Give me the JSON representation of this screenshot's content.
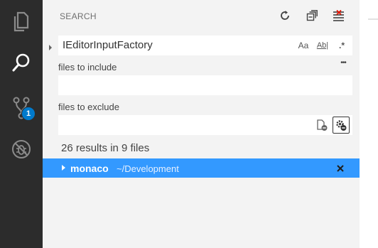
{
  "activity_bar": {
    "items": [
      {
        "icon": "files-icon"
      },
      {
        "icon": "search-icon",
        "active": true
      },
      {
        "icon": "source-control-icon",
        "badge": "1"
      },
      {
        "icon": "debug-icon"
      }
    ],
    "colors": {
      "background": "#2c2c2c",
      "active_icon": "#ffffff",
      "inactive_icon": "#8b8b8b",
      "badge": "#007acc"
    }
  },
  "search": {
    "title": "SEARCH",
    "actions": [
      "refresh-icon",
      "collapse-all-icon",
      "clear-results-icon"
    ],
    "query": "IEditorInputFactory",
    "options": {
      "match_case": "Aa",
      "whole_word": "Ab|",
      "regex": ".*"
    },
    "more_label": "•••",
    "files_to_include": {
      "label": "files to include",
      "value": ""
    },
    "files_to_exclude": {
      "label": "files to exclude",
      "value": ""
    },
    "exclude_buttons": [
      "exclude-settings-icon",
      "use-ignore-files-icon"
    ],
    "summary": "26 results in 9 files"
  },
  "results": [
    {
      "name": "monaco",
      "path": "~/Development",
      "selected": true
    }
  ],
  "colors": {
    "sidebar_bg": "#f3f3f3",
    "selection": "#3399ff",
    "input_bg": "#ffffff"
  }
}
